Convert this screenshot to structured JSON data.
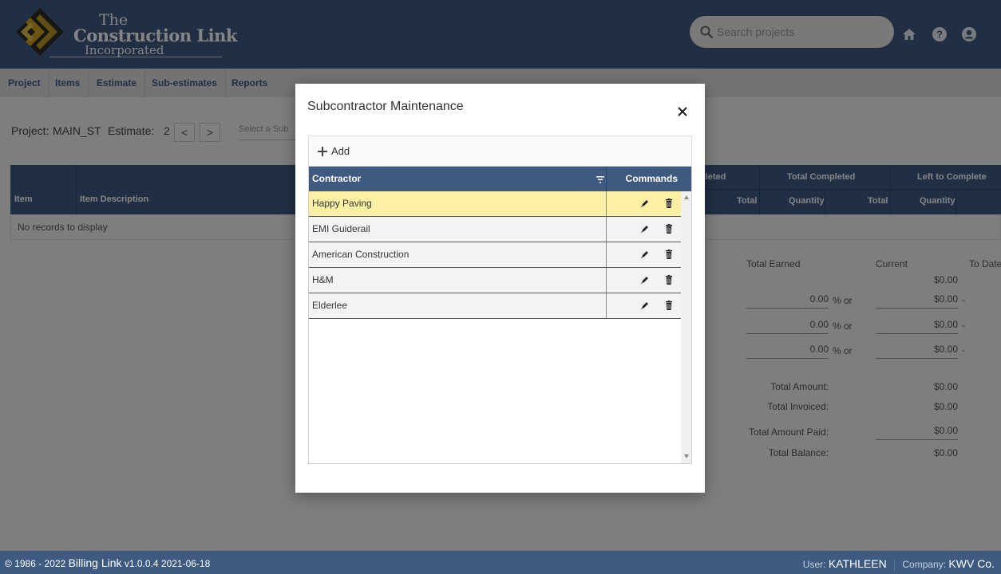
{
  "header": {
    "logo": {
      "the": "The",
      "main": "Construction Link",
      "inc": "Incorporated"
    },
    "search_placeholder": "Search projects",
    "icons": [
      "home-icon",
      "help-icon",
      "account-icon"
    ]
  },
  "nav": {
    "items": [
      "Project",
      "Items",
      "Estimate",
      "Sub-estimates",
      "Reports"
    ]
  },
  "project": {
    "project_label": "Project:",
    "project_value": "MAIN_ST",
    "estimate_label": "Estimate:",
    "estimate_value": "2",
    "prev": "<",
    "next": ">",
    "select_sub_placeholder": "Select a Sub"
  },
  "grid": {
    "col_item": "Item",
    "col_desc": "Item Description",
    "group_completed_partial": "pleted",
    "group_total_completed": "Total Completed",
    "group_left": "Left to Complete",
    "sub_total_1": "Total",
    "sub_quantity_1": "Quantity",
    "sub_total_2": "Total",
    "sub_quantity_2": "Quantity",
    "no_records": "No records to display"
  },
  "summary": {
    "hdr_total_earned": "Total Earned",
    "hdr_current": "Current",
    "hdr_to_date": "To Date",
    "current_top": "$0.00",
    "rows": [
      {
        "pct": "0.00",
        "pct_sign": "%",
        "or": "or",
        "amt": "$0.00",
        "dash": "-"
      },
      {
        "pct": "0.00",
        "pct_sign": "%",
        "or": "or",
        "amt": "$0.00",
        "dash": "-"
      },
      {
        "pct": "0.00",
        "pct_sign": "%",
        "or": "or",
        "amt": "$0.00",
        "dash": "-"
      }
    ],
    "total_amount_label": "Total Amount:",
    "total_amount": "$0.00",
    "total_invoiced_label": "Total Invoiced:",
    "total_invoiced": "$0.00",
    "total_paid_label": "Total Amount Paid:",
    "total_paid": "$0.00",
    "total_balance_label": "Total Balance:",
    "total_balance": "$0.00"
  },
  "modal": {
    "title": "Subcontractor Maintenance",
    "add_label": "Add",
    "col_contractor": "Contractor",
    "col_commands": "Commands",
    "contractors": [
      "Happy Paving",
      "EMI Guiderail",
      "American Construction",
      "H&M",
      "Elderlee"
    ],
    "selected_index": 0
  },
  "footer": {
    "copyright": "© 1986 - 2022",
    "app_name": "Billing Link",
    "version": "v1.0.0.4 2021-06-18",
    "user_label": "User:",
    "user_value": "KATHLEEN",
    "company_label": "Company:",
    "company_value": "KWV Co."
  },
  "colors": {
    "primary": "#3e5a80",
    "accent_gold": "#c9a227",
    "selected_row": "#fcf0a4"
  }
}
